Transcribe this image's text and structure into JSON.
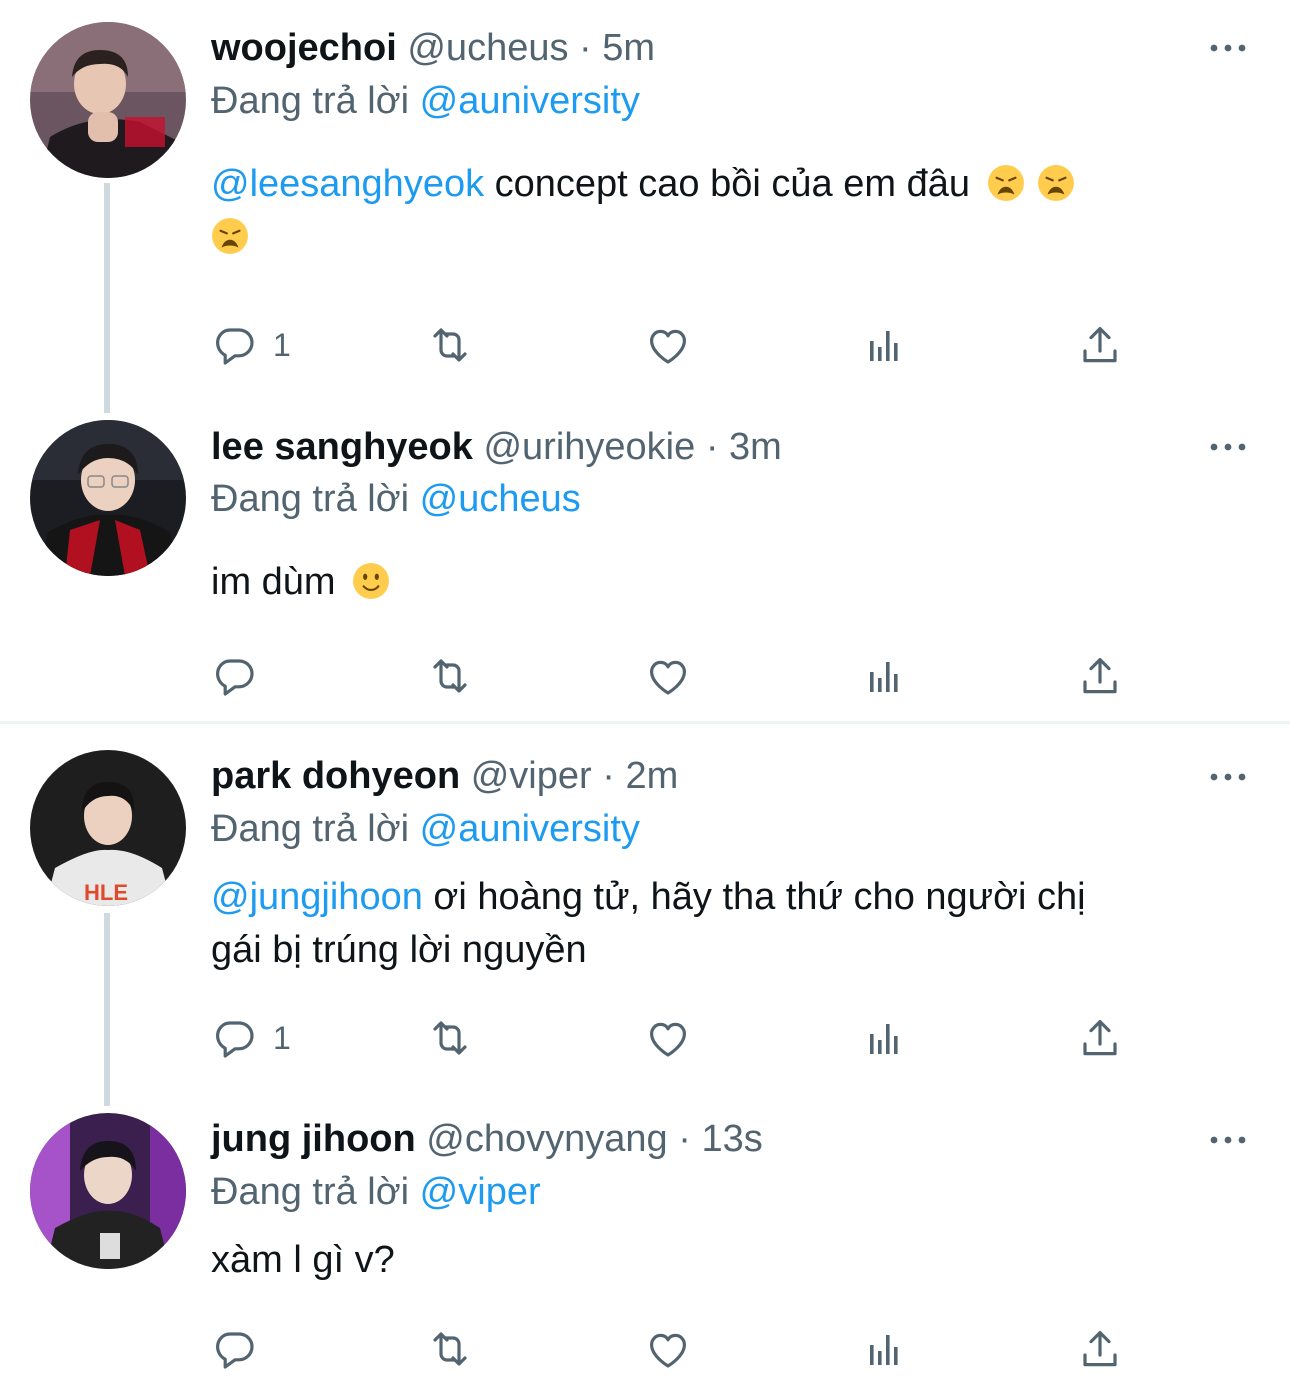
{
  "colors": {
    "link": "#1d9bf0",
    "secondary": "#536471",
    "text": "#0f1419",
    "thread_line": "#cfd9de"
  },
  "tweets": [
    {
      "name": "woojechoi",
      "handle": "@ucheus",
      "sep": "·",
      "time": "5m",
      "replying_prefix": "Đang trả lời",
      "replying_to": "@auniversity",
      "body_mention": "@leesanghyeok",
      "body_text": " concept cao bồi của em đâu",
      "body_emoji": [
        "weary-face",
        "weary-face",
        "weary-face"
      ],
      "reply_count": "1"
    },
    {
      "name": "lee sanghyeok",
      "handle": "@urihyeokie",
      "sep": "·",
      "time": "3m",
      "replying_prefix": "Đang trả lời",
      "replying_to": "@ucheus",
      "body_text": "im dùm",
      "body_emoji": [
        "slightly-smiling-face"
      ],
      "reply_count": ""
    },
    {
      "name": "park dohyeon",
      "handle": "@viper",
      "sep": "·",
      "time": "2m",
      "replying_prefix": "Đang trả lời",
      "replying_to": "@auniversity",
      "body_mention": "@jungjihoon",
      "body_text_line1": " ơi hoàng tử, hãy tha thứ cho người chị",
      "body_text_line2": "gái bị trúng lời nguyền",
      "reply_count": "1"
    },
    {
      "name": "jung jihoon",
      "handle": "@chovynyang",
      "sep": "·",
      "time": "13s",
      "replying_prefix": "Đang trả lời",
      "replying_to": "@viper",
      "body_text": "xàm l gì v?",
      "reply_count": ""
    }
  ],
  "icons": [
    "reply-icon",
    "retweet-icon",
    "like-icon",
    "analytics-icon",
    "share-icon",
    "more-icon"
  ]
}
